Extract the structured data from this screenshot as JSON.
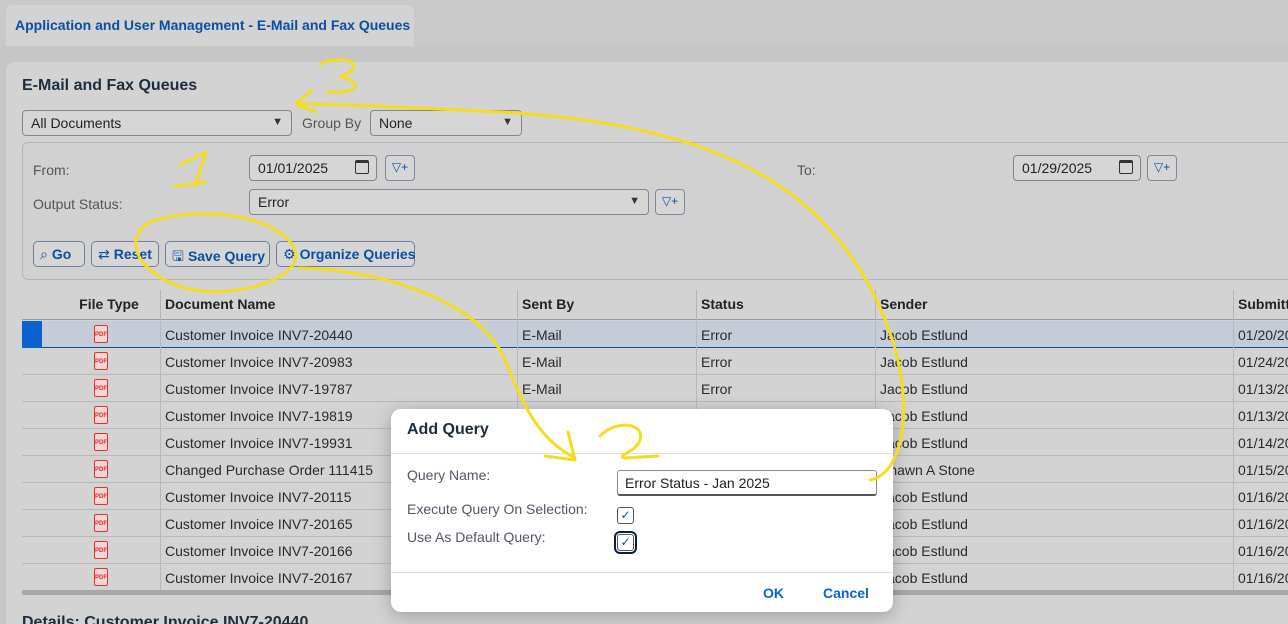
{
  "tab": {
    "title": "Application and User Management - E-Mail and Fax Queues"
  },
  "page": {
    "title": "E-Mail and Fax Queues",
    "details_title": "Details: Customer Invoice INV7-20440"
  },
  "toolbar": {
    "view_select": "All Documents",
    "group_by_label": "Group By",
    "group_by_value": "None"
  },
  "filters": {
    "from_label": "From:",
    "from_value": "01/01/2025",
    "to_label": "To:",
    "to_value": "01/29/2025",
    "output_status_label": "Output Status:",
    "output_status_value": "Error"
  },
  "actions": {
    "go": "Go",
    "reset": "Reset",
    "save_query": "Save Query",
    "organize_queries": "Organize Queries"
  },
  "table": {
    "columns": [
      "File Type",
      "Document Name",
      "Sent By",
      "Status",
      "Sender",
      "Submitt"
    ],
    "rows": [
      {
        "name": "Customer Invoice INV7-20440",
        "sent_by": "E-Mail",
        "status": "Error",
        "sender": "Jacob Estlund",
        "submitted": "01/20/20"
      },
      {
        "name": "Customer Invoice INV7-20983",
        "sent_by": "E-Mail",
        "status": "Error",
        "sender": "Jacob Estlund",
        "submitted": "01/24/20"
      },
      {
        "name": "Customer Invoice INV7-19787",
        "sent_by": "E-Mail",
        "status": "Error",
        "sender": "Jacob Estlund",
        "submitted": "01/13/20"
      },
      {
        "name": "Customer Invoice INV7-19819",
        "sent_by": "",
        "status": "",
        "sender": "Jacob Estlund",
        "submitted": "01/13/20"
      },
      {
        "name": "Customer Invoice INV7-19931",
        "sent_by": "",
        "status": "",
        "sender": "Jacob Estlund",
        "submitted": "01/14/20"
      },
      {
        "name": "Changed Purchase Order 111415",
        "sent_by": "",
        "status": "",
        "sender": "Shawn A Stone",
        "submitted": "01/15/20"
      },
      {
        "name": "Customer Invoice INV7-20115",
        "sent_by": "",
        "status": "",
        "sender": "Jacob Estlund",
        "submitted": "01/16/20"
      },
      {
        "name": "Customer Invoice INV7-20165",
        "sent_by": "",
        "status": "",
        "sender": "Jacob Estlund",
        "submitted": "01/16/20"
      },
      {
        "name": "Customer Invoice INV7-20166",
        "sent_by": "",
        "status": "",
        "sender": "Jacob Estlund",
        "submitted": "01/16/20"
      },
      {
        "name": "Customer Invoice INV7-20167",
        "sent_by": "",
        "status": "",
        "sender": "Jacob Estlund",
        "submitted": "01/16/20"
      }
    ],
    "pdf_badge": "PDF"
  },
  "dialog": {
    "title": "Add Query",
    "query_name_label": "Query Name:",
    "query_name_value": "Error Status - Jan 2025",
    "execute_label": "Execute Query On Selection:",
    "default_label": "Use As Default Query:",
    "execute_checked": true,
    "default_checked": true,
    "ok": "OK",
    "cancel": "Cancel"
  },
  "annotations": {
    "one": "1",
    "two": "2",
    "three": "3",
    "color": "#f5dc1e"
  }
}
